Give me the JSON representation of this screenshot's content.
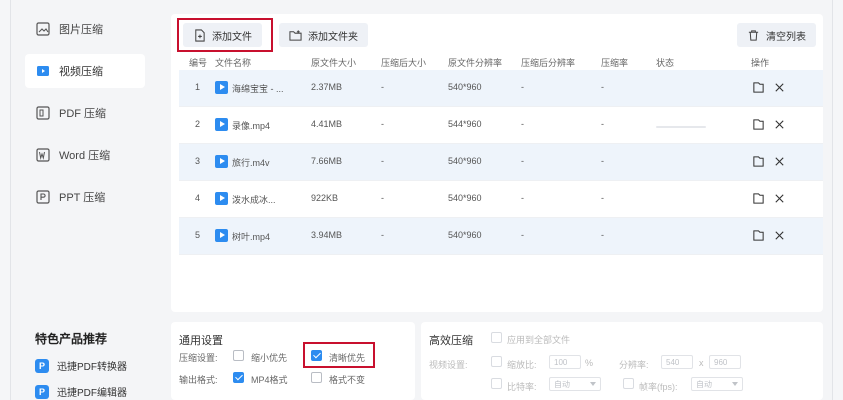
{
  "sidebar": {
    "items": [
      {
        "label": "图片压缩",
        "icon": "image-icon"
      },
      {
        "label": "视频压缩",
        "icon": "video-icon"
      },
      {
        "label": "PDF 压缩",
        "icon": "pdf-icon"
      },
      {
        "label": "Word 压缩",
        "icon": "word-icon"
      },
      {
        "label": "PPT 压缩",
        "icon": "ppt-icon"
      }
    ],
    "promo_title": "特色产品推荐",
    "promo_items": [
      {
        "label": "迅捷PDF转换器",
        "badge": "P"
      },
      {
        "label": "迅捷PDF编辑器",
        "badge": "P"
      }
    ]
  },
  "toolbar": {
    "add_file": "添加文件",
    "add_folder": "添加文件夹",
    "clear_list": "清空列表"
  },
  "table": {
    "headers": {
      "index": "编号",
      "name": "文件名称",
      "orig_size": "原文件大小",
      "comp_size": "压缩后大小",
      "orig_res": "原文件分辨率",
      "comp_res": "压缩后分辨率",
      "ratio": "压缩率",
      "status": "状态",
      "action": "操作"
    },
    "rows": [
      {
        "index": "1",
        "name": "海绵宝宝 - ...",
        "orig_size": "2.37MB",
        "comp_size": "-",
        "orig_res": "540*960",
        "comp_res": "-",
        "ratio": "-"
      },
      {
        "index": "2",
        "name": "录像.mp4",
        "orig_size": "4.41MB",
        "comp_size": "-",
        "orig_res": "544*960",
        "comp_res": "-",
        "ratio": "-"
      },
      {
        "index": "3",
        "name": "旅行.m4v",
        "orig_size": "7.66MB",
        "comp_size": "-",
        "orig_res": "540*960",
        "comp_res": "-",
        "ratio": "-"
      },
      {
        "index": "4",
        "name": "泼水成冰...",
        "orig_size": "922KB",
        "comp_size": "-",
        "orig_res": "540*960",
        "comp_res": "-",
        "ratio": "-"
      },
      {
        "index": "5",
        "name": "树叶.mp4",
        "orig_size": "3.94MB",
        "comp_size": "-",
        "orig_res": "540*960",
        "comp_res": "-",
        "ratio": "-"
      }
    ]
  },
  "general_settings": {
    "title": "通用设置",
    "compress_label": "压缩设置:",
    "opt_small": "缩小优先",
    "opt_clear": "清晰优先",
    "output_label": "输出格式:",
    "opt_mp4": "MP4格式",
    "opt_keep": "格式不变"
  },
  "advanced": {
    "title": "高效压缩",
    "apply_all": "应用到全部文件",
    "video_label": "视频设置:",
    "scale_label": "缩放比:",
    "scale_value": "100",
    "scale_unit": "%",
    "res_label": "分辨率:",
    "res_w": "540",
    "res_x": "x",
    "res_h": "960",
    "bitrate_label": "比特率:",
    "bitrate_value": "自动",
    "fps_label": "帧率(fps):",
    "fps_value": "自动"
  },
  "colors": {
    "accent": "#2d8cf0",
    "highlight_box": "#c8102e"
  }
}
